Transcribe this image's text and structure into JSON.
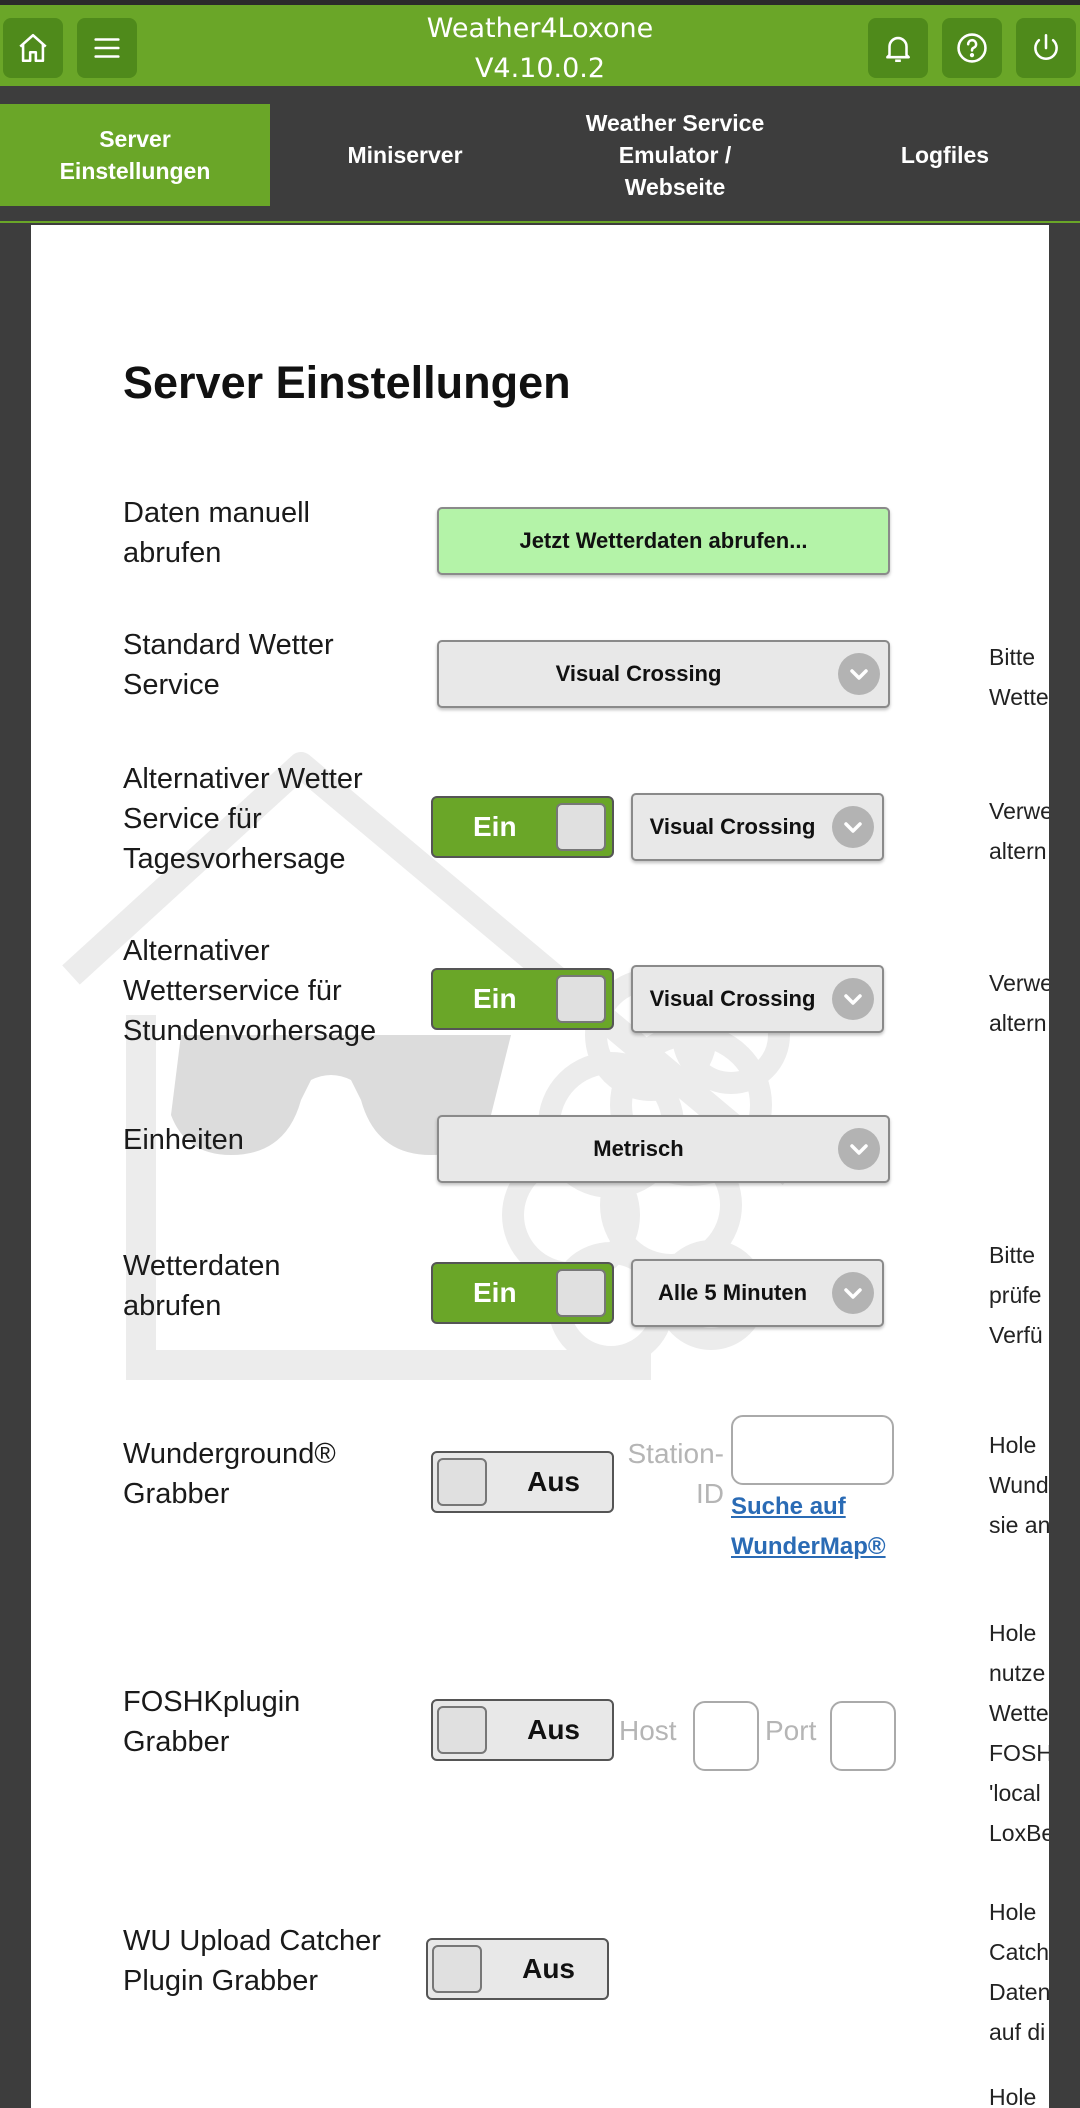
{
  "header": {
    "title_line1": "Weather4Loxone",
    "title_line2": "V4.10.0.2",
    "icons": [
      "home-icon",
      "menu-icon",
      "bell-icon",
      "help-icon",
      "power-icon"
    ]
  },
  "tabs": [
    {
      "label": "Server Einstellungen",
      "active": true
    },
    {
      "label": "Miniserver",
      "active": false
    },
    {
      "label": "Weather Service Emulator / Webseite",
      "active": false
    },
    {
      "label": "Logfiles",
      "active": false
    }
  ],
  "page": {
    "title": "Server Einstellungen",
    "rows": {
      "manual": {
        "label": "Daten manuell abrufen",
        "button": "Jetzt Wetterdaten abrufen..."
      },
      "standard": {
        "label": "Standard Wetter Service",
        "select": "Visual Crossing",
        "desc": [
          "Bitte",
          "Wette"
        ]
      },
      "daily": {
        "label": "Alternativer Wetter Service für Tagesvorhersage",
        "toggle": "Ein",
        "select": "Visual Crossing",
        "desc": [
          "Verwe",
          "altern"
        ]
      },
      "hourly": {
        "label": "Alternativer Wetterservice für Stundenvorhersage",
        "toggle": "Ein",
        "select": "Visual Crossing",
        "desc": [
          "Verwe",
          "altern"
        ]
      },
      "units": {
        "label": "Einheiten",
        "select": "Metrisch"
      },
      "fetch": {
        "label": "Wetterdaten abrufen",
        "toggle": "Ein",
        "select": "Alle 5 Minuten",
        "desc": [
          "Bitte",
          "prüfe",
          "Verfü"
        ]
      },
      "wunderground": {
        "label": "Wunderground® Grabber",
        "toggle": "Aus",
        "station_label": "Station-ID",
        "station_value": "",
        "link": "Suche auf WunderMap®",
        "desc": [
          "Hole",
          "Wund",
          "sie an"
        ]
      },
      "foshk": {
        "label": "FOSHKplugin Grabber",
        "toggle": "Aus",
        "host_label": "Host",
        "port_label": "Port",
        "desc": [
          "Hole",
          "nutze",
          "Wette",
          "FOSH",
          "'local",
          "LoxBe"
        ]
      },
      "wu_catcher": {
        "label": "WU Upload Catcher Plugin Grabber",
        "toggle": "Aus",
        "desc": [
          "Hole",
          "Catch",
          "Daten",
          "auf di"
        ]
      },
      "next_desc": [
        "Hole"
      ]
    }
  },
  "colors": {
    "brand_green": "#6aa628",
    "dark_bg": "#3d3d3d",
    "button_green": "#b4f3a8"
  }
}
